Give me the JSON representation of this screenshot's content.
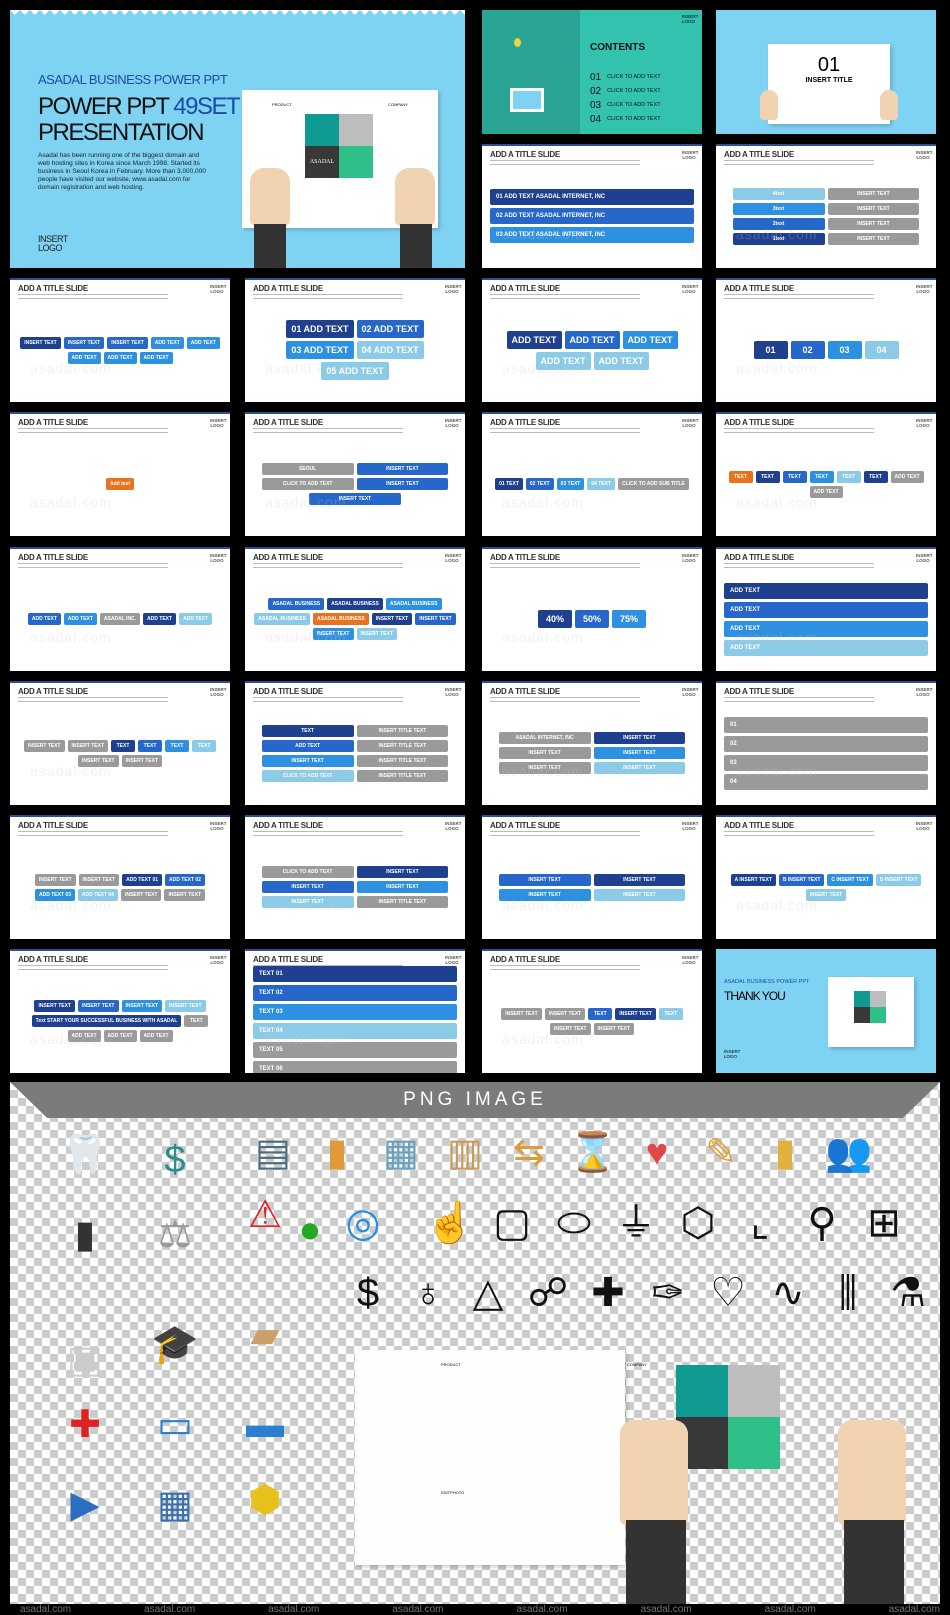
{
  "cover": {
    "brand": "ASADAL BUSINESS POWER PPT",
    "title_main": "POWER PPT",
    "title_accent": "49SET",
    "title_line2": "PRESENTATION",
    "description": "Asadal has been running one of the biggest domain and web hosting sites in Korea since March 1998. Started its business in Seoul Korea in February. More than 3,000,000 people have visited our website, www.asadal.com for domain registration and web hosting.",
    "logo": "INSERT LOGO",
    "puzzle_label": "ASADAL",
    "puzzle_left": "PRODUCT",
    "puzzle_right": "COMPANY"
  },
  "colors": {
    "navy": "#1f3f8f",
    "blue": "#2667c9",
    "bright": "#2e90e0",
    "light": "#8ccbe8",
    "grey": "#9a9a9a",
    "orange": "#e8731c",
    "teal": "#2fbfa6",
    "sky": "#7fd3f2"
  },
  "contents": {
    "title": "CONTENTS",
    "logo": "INSERT LOGO",
    "items": [
      "01",
      "02",
      "03",
      "04"
    ],
    "item_label": "CLICK TO ADD TEXT"
  },
  "section": {
    "number": "01",
    "title": "INSERT TITLE"
  },
  "common": {
    "slide_title": "ADD A TITLE SLIDE",
    "logo": "INSERT LOGO"
  },
  "slides": [
    {
      "layout": "wide",
      "items": [
        [
          "01 ADD TEXT   ASADAL INTERNET, INC",
          "navy"
        ],
        [
          "02 ADD TEXT   ASADAL INTERNET, INC",
          "blue"
        ],
        [
          "03 ADD TEXT   ASADAL INTERNET, INC",
          "bright"
        ]
      ]
    },
    {
      "layout": "two",
      "items": [
        [
          "4text",
          "light"
        ],
        [
          "INSERT TEXT",
          "grey"
        ],
        [
          "3text",
          "bright"
        ],
        [
          "INSERT TEXT",
          "grey"
        ],
        [
          "2text",
          "blue"
        ],
        [
          "INSERT TEXT",
          "grey"
        ],
        [
          "1text",
          "navy"
        ],
        [
          "INSERT TEXT",
          "grey"
        ]
      ]
    },
    {
      "layout": "",
      "items": [
        [
          "INSERT TEXT",
          "navy"
        ],
        [
          "INSERT TEXT",
          "blue"
        ],
        [
          "INSERT TEXT",
          "blue"
        ],
        [
          "ADD TEXT",
          "bright"
        ],
        [
          "ADD TEXT",
          "bright"
        ],
        [
          "ADD TEXT",
          "bright"
        ],
        [
          "ADD TEXT",
          "bright"
        ],
        [
          "ADD TEXT",
          "bright"
        ]
      ]
    },
    {
      "layout": "big",
      "items": [
        [
          "01 ADD TEXT",
          "navy"
        ],
        [
          "02 ADD TEXT",
          "blue"
        ],
        [
          "03 ADD TEXT",
          "bright"
        ],
        [
          "04 ADD TEXT",
          "light"
        ],
        [
          "05 ADD TEXT",
          "light"
        ]
      ]
    },
    {
      "layout": "big",
      "items": [
        [
          "ADD TEXT",
          "navy"
        ],
        [
          "ADD TEXT",
          "blue"
        ],
        [
          "ADD TEXT",
          "bright"
        ],
        [
          "ADD TEXT",
          "light"
        ],
        [
          "ADD TEXT",
          "light"
        ]
      ]
    },
    {
      "layout": "big",
      "items": [
        [
          "01",
          "navy"
        ],
        [
          "02",
          "blue"
        ],
        [
          "03",
          "bright"
        ],
        [
          "04",
          "light"
        ]
      ]
    },
    {
      "layout": "",
      "items": [
        [
          "Add text",
          "orange"
        ]
      ]
    },
    {
      "layout": "two",
      "items": [
        [
          "SEOUL",
          "grey"
        ],
        [
          "INSERT TEXT",
          "blue"
        ],
        [
          "CLICK TO ADD TEXT",
          "grey"
        ],
        [
          "INSERT TEXT",
          "blue"
        ],
        [
          "INSERT TEXT",
          "blue"
        ]
      ]
    },
    {
      "layout": "",
      "items": [
        [
          "01 TEXT",
          "navy"
        ],
        [
          "02 TEXT",
          "blue"
        ],
        [
          "03 TEXT",
          "bright"
        ],
        [
          "04 TEXT",
          "light"
        ],
        [
          "CLICK TO ADD SUB TITLE",
          "grey"
        ]
      ]
    },
    {
      "layout": "",
      "items": [
        [
          "TEXT",
          "orange"
        ],
        [
          "TEXT",
          "navy"
        ],
        [
          "TEXT",
          "blue"
        ],
        [
          "TEXT",
          "bright"
        ],
        [
          "TEXT",
          "light"
        ],
        [
          "TEXT",
          "navy"
        ],
        [
          "ADD TEXT",
          "grey"
        ],
        [
          "ADD TEXT",
          "grey"
        ]
      ]
    },
    {
      "layout": "",
      "items": [
        [
          "ADD TEXT",
          "blue"
        ],
        [
          "ADD TEXT",
          "bright"
        ],
        [
          "ASADAL INC.",
          "grey"
        ],
        [
          "ADD TEXT",
          "navy"
        ],
        [
          "ADD TEXT",
          "light"
        ]
      ]
    },
    {
      "layout": "",
      "items": [
        [
          "ASADAL BUSINESS",
          "blue"
        ],
        [
          "ASADAL BUSINESS",
          "navy"
        ],
        [
          "ASADAL BUSINESS",
          "bright"
        ],
        [
          "ASADAL BUSINESS",
          "light"
        ],
        [
          "ASADAL BUSINESS",
          "orange"
        ],
        [
          "INSERT TEXT",
          "navy"
        ],
        [
          "INSERT TEXT",
          "blue"
        ],
        [
          "INSERT TEXT",
          "bright"
        ],
        [
          "INSERT TEXT",
          "light"
        ]
      ]
    },
    {
      "layout": "big",
      "items": [
        [
          "40%",
          "navy"
        ],
        [
          "50%",
          "blue"
        ],
        [
          "75%",
          "bright"
        ]
      ]
    },
    {
      "layout": "wide",
      "items": [
        [
          "ADD TEXT",
          "navy"
        ],
        [
          "ADD TEXT",
          "blue"
        ],
        [
          "ADD TEXT",
          "bright"
        ],
        [
          "ADD TEXT",
          "light"
        ]
      ]
    },
    {
      "layout": "",
      "items": [
        [
          "INSERT TEXT",
          "grey"
        ],
        [
          "INSERT TEXT",
          "grey"
        ],
        [
          "TEXT",
          "navy"
        ],
        [
          "TEXT",
          "blue"
        ],
        [
          "TEXT",
          "bright"
        ],
        [
          "TEXT",
          "light"
        ],
        [
          "INSERT TEXT",
          "grey"
        ],
        [
          "INSERT TEXT",
          "grey"
        ]
      ]
    },
    {
      "layout": "two",
      "items": [
        [
          "TEXT",
          "navy"
        ],
        [
          "INSERT TITLE TEXT",
          "grey"
        ],
        [
          "ADD TEXT",
          "blue"
        ],
        [
          "INSERT TITLE TEXT",
          "grey"
        ],
        [
          "INSERT TEXT",
          "bright"
        ],
        [
          "INSERT TITLE TEXT",
          "grey"
        ],
        [
          "CLICK TO ADD TEXT",
          "light"
        ],
        [
          "INSERT TITLE TEXT",
          "grey"
        ]
      ]
    },
    {
      "layout": "two",
      "items": [
        [
          "ASADAL INTERNET, INC",
          "grey"
        ],
        [
          "INSERT TEXT",
          "navy"
        ],
        [
          "INSERT TEXT",
          "grey"
        ],
        [
          "INSERT TEXT",
          "bright"
        ],
        [
          "INSERT TEXT",
          "grey"
        ],
        [
          "INSERT TEXT",
          "light"
        ]
      ]
    },
    {
      "layout": "wide",
      "items": [
        [
          "01",
          "grey"
        ],
        [
          "02",
          "grey"
        ],
        [
          "03",
          "grey"
        ],
        [
          "04",
          "grey"
        ]
      ]
    },
    {
      "layout": "",
      "items": [
        [
          "INSERT TEXT",
          "grey"
        ],
        [
          "INSERT TEXT",
          "grey"
        ],
        [
          "ADD TEXT 01",
          "navy"
        ],
        [
          "ADD TEXT 02",
          "blue"
        ],
        [
          "ADD TEXT 03",
          "bright"
        ],
        [
          "ADD TEXT 04",
          "light"
        ],
        [
          "INSERT TEXT",
          "grey"
        ],
        [
          "INSERT TEXT",
          "grey"
        ]
      ]
    },
    {
      "layout": "two",
      "items": [
        [
          "CLICK TO ADD TEXT",
          "grey"
        ],
        [
          "INSERT TEXT",
          "navy"
        ],
        [
          "INSERT TEXT",
          "blue"
        ],
        [
          "INSERT TEXT",
          "bright"
        ],
        [
          "INSERT TEXT",
          "light"
        ],
        [
          "INSERT TITLE TEXT",
          "grey"
        ]
      ]
    },
    {
      "layout": "two",
      "items": [
        [
          "INSERT TEXT",
          "blue"
        ],
        [
          "INSERT TEXT",
          "navy"
        ],
        [
          "INSERT TEXT",
          "bright"
        ],
        [
          "INSERT TEXT",
          "light"
        ]
      ]
    },
    {
      "layout": "",
      "items": [
        [
          "A INSERT TEXT",
          "navy"
        ],
        [
          "B INSERT TEXT",
          "blue"
        ],
        [
          "C INSERT TEXT",
          "bright"
        ],
        [
          "D INSERT TEXT",
          "light"
        ],
        [
          "INSERT TEXT",
          "light"
        ]
      ]
    },
    {
      "layout": "",
      "items": [
        [
          "INSERT TEXT",
          "navy"
        ],
        [
          "INSERT TEXT",
          "blue"
        ],
        [
          "INSERT TEXT",
          "bright"
        ],
        [
          "INSERT TEXT",
          "light"
        ],
        [
          "Text  START YOUR SUCCESSFUL BUSINESS WITH ASADAL",
          "navy"
        ],
        [
          "TEXT",
          "grey"
        ],
        [
          "ADD TEXT",
          "grey"
        ],
        [
          "ADD TEXT",
          "grey"
        ],
        [
          "ADD TEXT",
          "grey"
        ]
      ]
    },
    {
      "layout": "wide",
      "items": [
        [
          "TEXT 01",
          "navy"
        ],
        [
          "TEXT 02",
          "blue"
        ],
        [
          "TEXT 03",
          "bright"
        ],
        [
          "TEXT 04",
          "light"
        ],
        [
          "TEXT 05",
          "grey"
        ],
        [
          "TEXT 06",
          "grey"
        ]
      ]
    },
    {
      "layout": "",
      "items": [
        [
          "INSERT TEXT",
          "grey"
        ],
        [
          "INSERT TEXT",
          "grey"
        ],
        [
          "TEXT",
          "blue"
        ],
        [
          "INSERT TEXT",
          "navy"
        ],
        [
          "TEXT",
          "light"
        ],
        [
          "INSERT TEXT",
          "grey"
        ],
        [
          "INSERT TEXT",
          "grey"
        ]
      ]
    }
  ],
  "thankyou": {
    "brand": "ASADAL BUSINESS POWER PPT",
    "title": "THANK YOU",
    "logo": "INSERT LOGO"
  },
  "png_section": {
    "title": "PNG IMAGE",
    "watermark": "asadal.com",
    "paper_labels": [
      "PRODUCT",
      "COMPANY",
      "EDITPHOTO"
    ],
    "photo_icons": [
      [
        "tooth-icon",
        "🦷",
        "#eee"
      ],
      [
        "credit-card-icon",
        "$",
        "#2a8f8a"
      ],
      [
        "ct-scan-icon",
        "▮",
        "#333"
      ],
      [
        "scales-icon",
        "⚖",
        "#999"
      ],
      [
        "warning-sign-icon",
        "⚠",
        "#d22"
      ],
      [
        "traffic-light-icon",
        "●",
        "#2a2"
      ],
      [
        "xray-monitor-icon",
        "▣",
        "#ccc"
      ],
      [
        "graduate-icon",
        "🎓",
        "#333"
      ],
      [
        "toolbox-icon",
        "▰",
        "#c9a06a"
      ],
      [
        "ambulance-icon",
        "✚",
        "#d22"
      ],
      [
        "computer-icon",
        "▭",
        "#2a7fd0"
      ],
      [
        "car-icon",
        "▬",
        "#2a7fd0"
      ],
      [
        "train-icon",
        "▶",
        "#2a6fc0"
      ],
      [
        "calculator-icon",
        "▦",
        "#3a6fb0"
      ],
      [
        "stop-sign-icon",
        "⬢",
        "#e8c21c"
      ]
    ],
    "flat_icons": [
      [
        "folder-icon",
        "▤",
        "#4a6b80"
      ],
      [
        "usb-icon",
        "▮",
        "#e09a3a"
      ],
      [
        "browser-icon",
        "▦",
        "#6aa0c0"
      ],
      [
        "calendar-icon",
        "▥",
        "#c99a5a"
      ],
      [
        "signpost-icon",
        "⇆",
        "#e09a3a"
      ],
      [
        "hourglass-icon",
        "⌛",
        "#8aa"
      ],
      [
        "heart-icon",
        "♥",
        "#e04848"
      ],
      [
        "syringe-icon",
        "✎",
        "#e0a040"
      ],
      [
        "pill-bottle-icon",
        "▮",
        "#e0b040"
      ],
      [
        "handshake-icon",
        "👥",
        "#333"
      ]
    ],
    "outline_icons": [
      [
        "target-icon",
        "◎",
        "#2a8fe0"
      ],
      [
        "hand-pointer-icon",
        "☝",
        "#111"
      ],
      [
        "briefcase-icon",
        "▢",
        "#111"
      ],
      [
        "pills-icon",
        "⬭",
        "#111"
      ],
      [
        "plug-icon",
        "⏚",
        "#111"
      ],
      [
        "cube-3d-icon",
        "⬡",
        "#111"
      ],
      [
        "boot-icon",
        "⌞",
        "#111"
      ],
      [
        "lamp-icon",
        "⚲",
        "#111"
      ],
      [
        "clipboard-plus-icon",
        "⊞",
        "#111"
      ],
      [
        "money-bag-icon",
        "$",
        "#111"
      ],
      [
        "balloon-icon",
        "♁",
        "#111"
      ],
      [
        "pyramid-icon",
        "△",
        "#111"
      ],
      [
        "network-icon",
        "☍",
        "#111"
      ],
      [
        "medical-kit-icon",
        "✚",
        "#111"
      ],
      [
        "syringe-outline-icon",
        "✑",
        "#111"
      ],
      [
        "heart-outline-icon",
        "♡",
        "#111"
      ],
      [
        "stethoscope-icon",
        "∿",
        "#111"
      ],
      [
        "test-tubes-icon",
        "⫼",
        "#111"
      ],
      [
        "flask-icon",
        "⚗",
        "#111"
      ]
    ]
  }
}
